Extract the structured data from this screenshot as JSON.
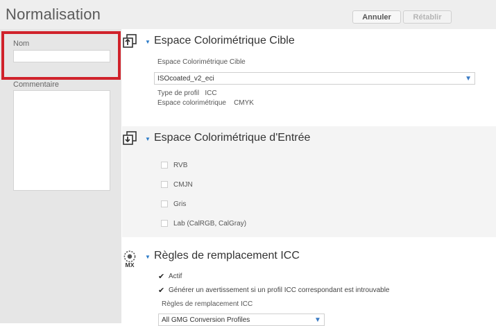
{
  "header": {
    "title": "Normalisation",
    "cancel_label": "Annuler",
    "restore_label": "Rétablir"
  },
  "left": {
    "name_label": "Nom",
    "name_value": "",
    "comment_label": "Commentaire",
    "comment_value": ""
  },
  "target_space": {
    "title": "Espace Colorimétrique Cible",
    "field_label": "Espace Colorimétrique Cible",
    "selected_profile": "ISOcoated_v2_eci",
    "profile_type_label": "Type de profil",
    "profile_type_value": "ICC",
    "color_space_label": "Espace colorimétrique",
    "color_space_value": "CMYK"
  },
  "input_space": {
    "title": "Espace Colorimétrique d'Entrée",
    "options": [
      {
        "label": "RVB",
        "checked": false
      },
      {
        "label": "CMJN",
        "checked": false
      },
      {
        "label": "Gris",
        "checked": false
      },
      {
        "label": "Lab (CalRGB, CalGray)",
        "checked": false
      }
    ]
  },
  "icc_rules": {
    "title": "Règles de remplacement ICC",
    "active_label": "Actif",
    "active_checked": true,
    "warn_label": "Générer un avertissement si un profil ICC correspondant est introuvable",
    "warn_checked": true,
    "rules_label": "Règles de remplacement ICC",
    "rules_value": "All GMG Conversion Profiles",
    "icon_text": "MX"
  },
  "colors": {
    "accent": "#2a7ac7",
    "highlight": "#d0222b"
  }
}
